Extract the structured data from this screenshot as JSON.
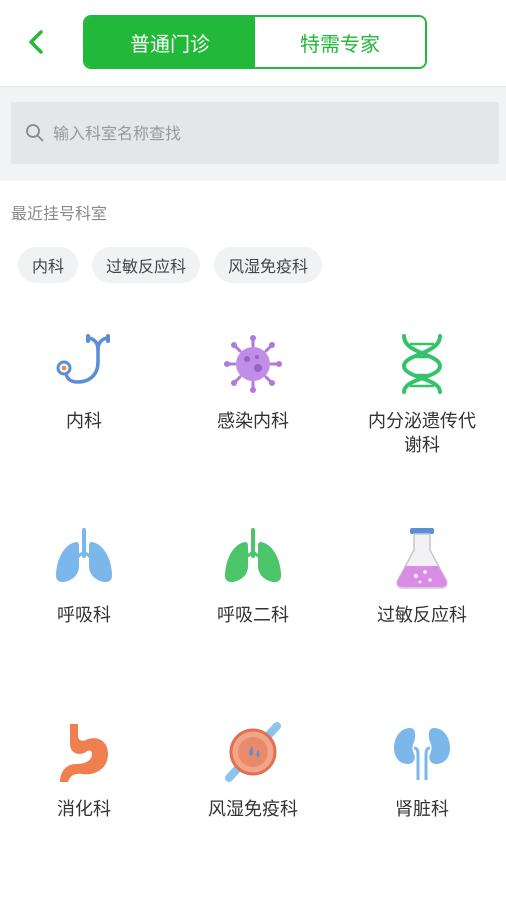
{
  "header": {
    "tabs": [
      {
        "label": "普通门诊",
        "active": true
      },
      {
        "label": "特需专家",
        "active": false
      }
    ],
    "accent": "#22b83a"
  },
  "search": {
    "placeholder": "输入科室名称查找",
    "value": ""
  },
  "recent": {
    "title": "最近挂号科室",
    "chips": [
      "内科",
      "过敏反应科",
      "风湿免疫科"
    ]
  },
  "departments": [
    {
      "label": "内科",
      "icon": "stethoscope-icon"
    },
    {
      "label": "感染内科",
      "icon": "virus-icon"
    },
    {
      "label": "内分泌遗传代谢科",
      "icon": "dna-icon"
    },
    {
      "label": "呼吸科",
      "icon": "lungs-blue-icon"
    },
    {
      "label": "呼吸二科",
      "icon": "lungs-green-icon"
    },
    {
      "label": "过敏反应科",
      "icon": "flask-icon"
    },
    {
      "label": "消化科",
      "icon": "stomach-icon"
    },
    {
      "label": "风湿免疫科",
      "icon": "joint-icon"
    },
    {
      "label": "肾脏科",
      "icon": "kidney-icon"
    }
  ]
}
